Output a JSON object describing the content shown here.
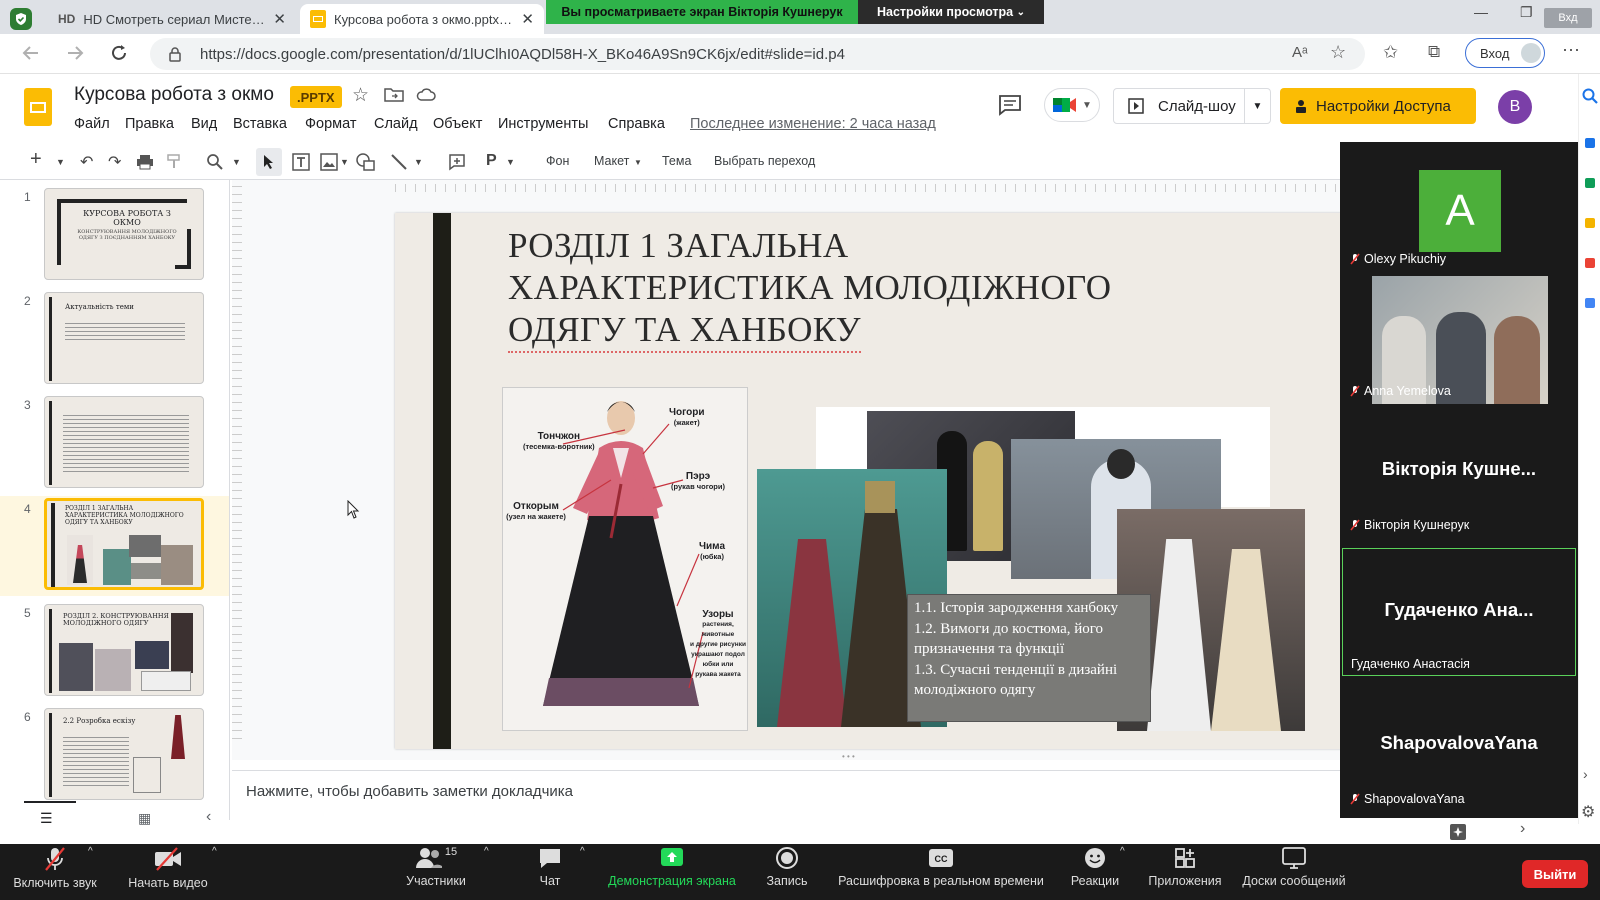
{
  "browser": {
    "tabs": [
      {
        "title": "HD Смотреть сериал Мистер Ошиб..."
      },
      {
        "title": "Курсова робота з окмо.pptx - G..."
      }
    ],
    "url": "https://docs.google.com/presentation/d/1lUClhI0AQDl58H-X_BKo46A9Sn9CK6jx/edit#slide=id.p4",
    "reader_label": "A",
    "signin_label": "Вход",
    "window_corner_label": "Вхд"
  },
  "zoom_banner": {
    "viewing_text": "Вы просматриваете экран Вікторія Кушнерук",
    "view_options": "Настройки просмотра"
  },
  "slides_app": {
    "doc_title": "Курсова робота з окмо",
    "badge": ".PPTX",
    "menu": [
      "Файл",
      "Правка",
      "Вид",
      "Вставка",
      "Формат",
      "Слайд",
      "Объект",
      "Инструменты",
      "Справка"
    ],
    "last_edit": "Последнее изменение: 2 часа назад",
    "slideshow_label": "Слайд-шоу",
    "share_label": "Настройки Доступа",
    "avatar_letter": "B",
    "toolbar": {
      "background": "Фон",
      "layout": "Макет",
      "theme": "Тема",
      "transition": "Выбрать переход"
    },
    "notes_placeholder": "Нажмите, чтобы добавить заметки докладчика"
  },
  "thumbnails": [
    {
      "num": "1",
      "title": "КУРСОВА РОБОТА З ОКМО",
      "sub": "КОНСТРУЮВАННЯ МОЛОДІЖНОГО ОДЯГУ З ПОЄДНАННЯМ ХАНБОКУ"
    },
    {
      "num": "2",
      "title": "Актуальність теми"
    },
    {
      "num": "3",
      "title": ""
    },
    {
      "num": "4",
      "title": "РОЗДІЛ 1 ЗАГАЛЬНА ХАРАКТЕРИСТИКА МОЛОДІЖНОГО ОДЯГУ ТА ХАНБОКУ"
    },
    {
      "num": "5",
      "title": "РОЗДІЛ 2. КОНСТРУЮВАННЯ МОЛОДІЖНОГО ОДЯГУ"
    },
    {
      "num": "6",
      "title": "2.2 Розробка ескізу"
    }
  ],
  "slide": {
    "title_lines": [
      "РОЗДІЛ 1 ЗАГАЛЬНА",
      "ХАРАКТЕРИСТИКА МОЛОДІЖНОГО",
      "ОДЯГУ ТА ХАНБОКУ"
    ],
    "hanbok_labels": {
      "tonchjon": "Тончжон",
      "tonchjon_sub": "(тесемка-воротник)",
      "chogori": "Чогори",
      "chogori_sub": "(жакет)",
      "pere": "Пэрэ",
      "pere_sub": "(рукав чогори)",
      "otkorym": "Откорым",
      "otkorym_sub": "(узел на жакете)",
      "chima": "Чима",
      "chima_sub": "(юбка)",
      "uzory": "Узоры",
      "uzory_sub1": "растения, животные",
      "uzory_sub2": "и другие рисунки",
      "uzory_sub3": "украшают подол",
      "uzory_sub4": "юбки или",
      "uzory_sub5": "рукава жакета"
    },
    "contents": [
      "1.1. Історія зародження ханбоку",
      "1.2. Вимоги до костюма, його призначення та функції",
      "1.3. Сучасні тенденції в дизайні молодіжного одягу"
    ]
  },
  "participants": [
    {
      "name": "Olexy Pikuchiy",
      "display": "A",
      "type": "avatar",
      "color": "#4caf3a"
    },
    {
      "name": "Anna Yemelova",
      "type": "video"
    },
    {
      "name": "Вікторія Кушнерук",
      "display": "Вікторія  Кушне...",
      "type": "name"
    },
    {
      "name": "Гудаченко Анастасія",
      "display": "Гудаченко  Ана...",
      "type": "name",
      "active": true
    },
    {
      "name": "ShapovalovaYana",
      "display": "ShapovalovaYana",
      "type": "name"
    }
  ],
  "zoom_controls": {
    "mute": "Включить звук",
    "video": "Начать видео",
    "participants": "Участники",
    "participants_count": "15",
    "chat": "Чат",
    "share": "Демонстрация экрана",
    "record": "Запись",
    "captions": "Расшифровка в реальном времени",
    "reactions": "Реакции",
    "apps": "Приложения",
    "whiteboards": "Доски сообщений",
    "leave": "Выйти"
  },
  "colors": {
    "slides_yellow": "#fbbc04",
    "zoom_green": "#23d959",
    "leave_red": "#e02828",
    "slide_bg": "#efebe5"
  }
}
